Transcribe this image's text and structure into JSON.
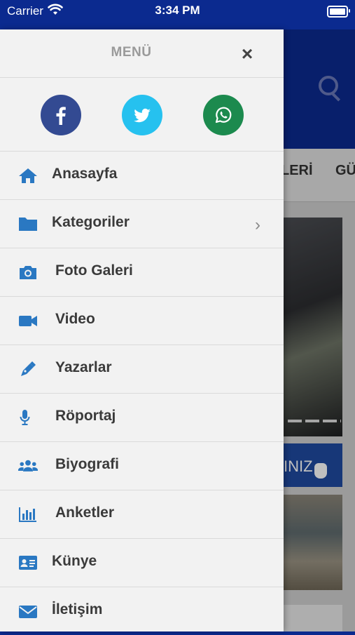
{
  "status_bar": {
    "carrier": "Carrier",
    "time": "3:34 PM",
    "wifi_icon": "wifi-icon",
    "battery_icon": "battery-icon"
  },
  "drawer": {
    "title": "MENÜ",
    "close_label": "×",
    "social": [
      {
        "name": "facebook",
        "icon": "facebook-icon",
        "color": "#334a92"
      },
      {
        "name": "twitter",
        "icon": "twitter-icon",
        "color": "#26c1ef"
      },
      {
        "name": "whatsapp",
        "icon": "whatsapp-icon",
        "color": "#1c8a4e"
      }
    ],
    "items": [
      {
        "label": "Anasayfa",
        "icon": "home-icon"
      },
      {
        "label": "Kategoriler",
        "icon": "folder-icon",
        "chevron": "›"
      },
      {
        "label": "Foto Galeri",
        "icon": "camera-icon"
      },
      {
        "label": "Video",
        "icon": "video-icon"
      },
      {
        "label": "Yazarlar",
        "icon": "pen-icon"
      },
      {
        "label": "Röportaj",
        "icon": "microphone-icon"
      },
      {
        "label": "Biyografi",
        "icon": "users-icon"
      },
      {
        "label": "Anketler",
        "icon": "chart-icon"
      },
      {
        "label": "Künye",
        "icon": "id-card-icon"
      },
      {
        "label": "İletişim",
        "icon": "envelope-icon"
      }
    ]
  },
  "background_app": {
    "tabs": [
      "LERİ",
      "GÜ"
    ],
    "banner_text": "INIZ",
    "search_icon": "search-icon"
  },
  "colors": {
    "brand_blue": "#0b2a8f",
    "icon_blue": "#2a78c2",
    "drawer_bg": "#f2f2f2"
  }
}
